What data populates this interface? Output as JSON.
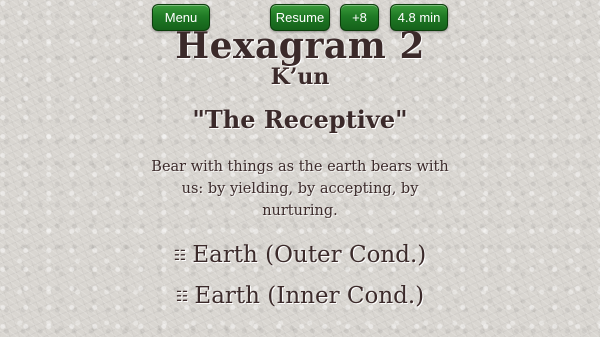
{
  "toolbar": {
    "menu_label": "Menu",
    "resume_label": "Resume",
    "plus_label": "+8",
    "time_label": "4.8 min"
  },
  "hexagram": {
    "title": "Hexagram 2",
    "romanization": "K’un",
    "name": "\"The Receptive\"",
    "description": "Bear with things as the earth bears with us: by yielding, by accepting, by nurturing."
  },
  "trigrams": {
    "outer": {
      "symbol": "☷",
      "icon": "earth-trigram-icon",
      "label": "Earth (Outer Cond.)"
    },
    "inner": {
      "symbol": "☷",
      "icon": "earth-trigram-icon",
      "label": "Earth (Inner Cond.)"
    }
  },
  "colors": {
    "button_green": "#1f7a25",
    "text": "#3b2a2a",
    "background": "#d9d6d1"
  }
}
